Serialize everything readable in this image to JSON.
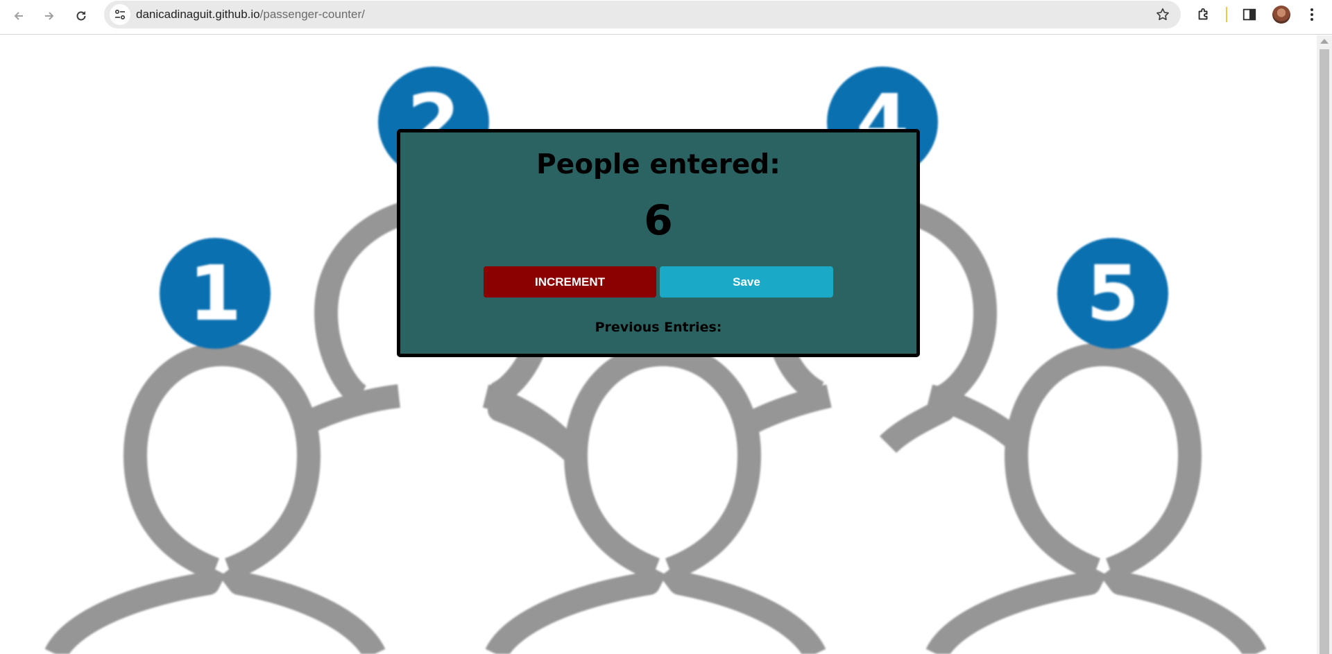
{
  "browser": {
    "url_domain": "danicadinaguit.github.io",
    "url_path": "/passenger-counter/",
    "icons": [
      "back-arrow-icon",
      "forward-arrow-icon",
      "reload-icon",
      "site-info-icon",
      "bookmark-star-icon",
      "extensions-icon",
      "side-panel-icon",
      "profile-avatar",
      "more-menu-icon"
    ]
  },
  "background": {
    "badges": [
      "1",
      "2",
      "4",
      "5"
    ],
    "colors": {
      "badge": "#0a70b0",
      "figure": "#969696"
    }
  },
  "counter": {
    "title": "People entered:",
    "count": "6",
    "increment_label": "INCREMENT",
    "save_label": "Save",
    "previous_entries_label": "Previous Entries:"
  },
  "colors": {
    "card_bg": "#2b6262",
    "increment_bg": "#8b0000",
    "save_bg": "#1aaac8"
  }
}
